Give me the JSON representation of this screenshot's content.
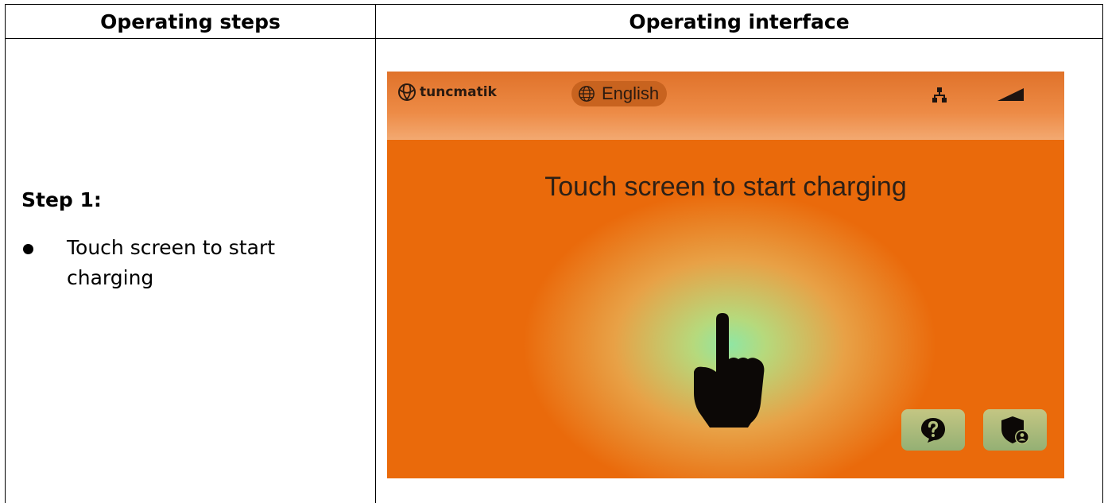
{
  "table": {
    "col_steps_header": "Operating steps",
    "col_interface_header": "Operating interface"
  },
  "step": {
    "title": "Step 1:",
    "bullet": "Touch screen to start charging"
  },
  "screen": {
    "logo_text": "tuncmatik",
    "logo_icon": "globe-icon",
    "language": "English",
    "language_icon": "globe-icon",
    "network_icon": "network-icon",
    "signal_icon": "signal-icon",
    "headline": "Touch screen to start charging",
    "hand_icon": "pointing-hand-icon",
    "help_icon": "question-icon",
    "admin_icon": "shield-user-icon",
    "colors": {
      "background": "#ea6a0b",
      "glow": "#8fe6a4",
      "button": "#b4c07d"
    }
  }
}
